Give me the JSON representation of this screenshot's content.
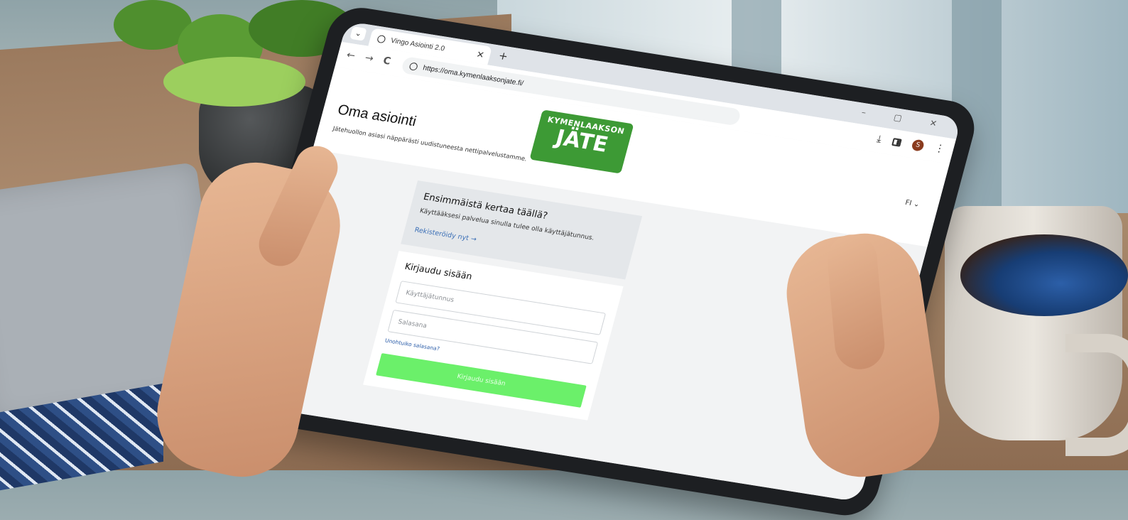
{
  "browser": {
    "tab_title": "Vingo Asiointi 2.0",
    "tab_close": "×",
    "new_tab": "+",
    "url": "https://oma.kymenlaaksonjate.fi/",
    "back": "←",
    "forward": "→",
    "reload": "C",
    "download": "⤓",
    "avatar_letter": "S",
    "menu": "⋮",
    "window_controls": "– ▢ ✕",
    "tab_chevron": "⌄"
  },
  "header": {
    "title": "Oma asiointi",
    "subtitle": "Jätehuollon asiasi näppärästi uudistuneesta nettipalvelustamme.",
    "logo_top": "KYMENLAAKSON",
    "logo_bottom": "JÄTE",
    "language": "FI ⌄"
  },
  "register": {
    "title": "Ensimmäistä kertaa täällä?",
    "text": "Käyttääksesi palvelua sinulla tulee olla käyttäjätunnus.",
    "link": "Rekisteröidy nyt →"
  },
  "login": {
    "title": "Kirjaudu sisään",
    "username_placeholder": "Käyttäjätunnus",
    "password_placeholder": "Salasana",
    "forgot": "Unohtuiko salasana?",
    "submit": "Kirjaudu sisään"
  },
  "colors": {
    "brand_green": "#3d9a35",
    "button_green": "#6bf06a",
    "link_blue": "#3b6fb6"
  }
}
